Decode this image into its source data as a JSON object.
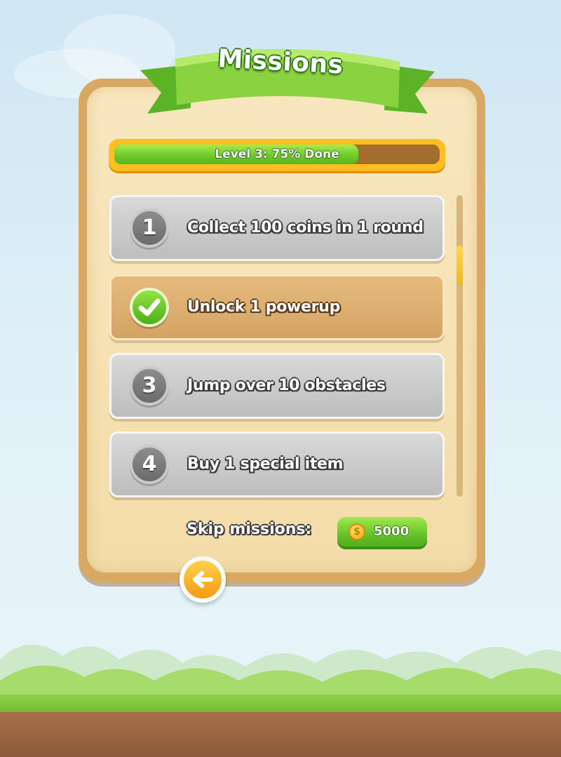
{
  "header": {
    "title": "Missions"
  },
  "progress": {
    "label": "Level 3: 75% Done",
    "fraction": 0.75
  },
  "missions": [
    {
      "badge": "1",
      "text": "Collect 100 coins in 1 round",
      "status": "pending"
    },
    {
      "badge": "check-icon",
      "text": "Unlock 1 powerup",
      "status": "done"
    },
    {
      "badge": "3",
      "text": "Jump over 10 obstacles",
      "status": "pending"
    },
    {
      "badge": "4",
      "text": "Buy 1 special item",
      "status": "pending"
    }
  ],
  "skip": {
    "label": "Skip missions:",
    "cost": "5000",
    "currency_icon": "coin-icon"
  },
  "back_button": {
    "icon": "back-arrow-icon"
  },
  "colors": {
    "accent_green": "#6ecb2a",
    "accent_orange": "#ffbe21",
    "panel": "#f3dca8",
    "mission_pending": "#c8c8c8",
    "mission_done": "#d8a96a"
  }
}
